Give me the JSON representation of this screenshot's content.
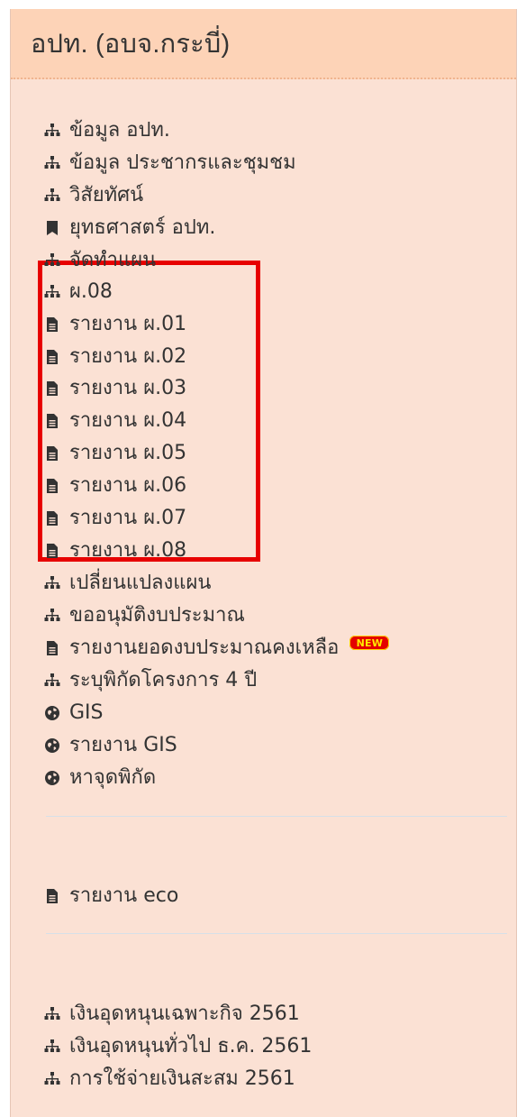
{
  "header": {
    "title": "อปท. (อบจ.กระบี่)"
  },
  "menu": {
    "items": [
      {
        "label": "ข้อมูล อปท.",
        "icon": "sitemap-icon"
      },
      {
        "label": "ข้อมูล ประชากรและชุมชม",
        "icon": "sitemap-icon"
      },
      {
        "label": "วิสัยทัศน์",
        "icon": "sitemap-icon"
      },
      {
        "label": "ยุทธศาสตร์ อปท.",
        "icon": "bookmark-icon"
      },
      {
        "label": "จัดทำแผน",
        "icon": "sitemap-icon"
      },
      {
        "label": "ผ.08",
        "icon": "sitemap-icon"
      },
      {
        "label": "รายงาน ผ.01",
        "icon": "document-icon"
      },
      {
        "label": "รายงาน ผ.02",
        "icon": "document-icon"
      },
      {
        "label": "รายงาน ผ.03",
        "icon": "document-icon"
      },
      {
        "label": "รายงาน ผ.04",
        "icon": "document-icon"
      },
      {
        "label": "รายงาน ผ.05",
        "icon": "document-icon"
      },
      {
        "label": "รายงาน ผ.06",
        "icon": "document-icon"
      },
      {
        "label": "รายงาน ผ.07",
        "icon": "document-icon"
      },
      {
        "label": "รายงาน ผ.08",
        "icon": "document-icon"
      },
      {
        "label": "เปลี่ยนแปลงแผน",
        "icon": "sitemap-icon"
      },
      {
        "label": "ขออนุมัติงบประมาณ",
        "icon": "sitemap-icon"
      },
      {
        "label": "รายงานยอดงบประมาณคงเหลือ",
        "icon": "document-icon",
        "badge": "NEW"
      },
      {
        "label": "ระบุพิกัดโครงการ 4 ปี",
        "icon": "sitemap-icon"
      },
      {
        "label": "GIS",
        "icon": "globe-icon"
      },
      {
        "label": "รายงาน GIS",
        "icon": "globe-icon"
      },
      {
        "label": "หาจุดพิกัด",
        "icon": "globe-icon"
      },
      {
        "label": "รายงาน eco",
        "icon": "document-icon"
      },
      {
        "label": "เงินอุดหนุนเฉพาะกิจ 2561",
        "icon": "sitemap-icon"
      },
      {
        "label": "เงินอุดหนุนทั่วไป ธ.ค. 2561",
        "icon": "sitemap-icon"
      },
      {
        "label": "การใช้จ่ายเงินสะสม 2561",
        "icon": "sitemap-icon"
      }
    ]
  },
  "colors": {
    "panel_background": "#fbe1d4",
    "header_background": "#fdd3b7",
    "highlight_border": "#e70000",
    "badge_background": "#e40000",
    "badge_text": "#ffeb00"
  }
}
